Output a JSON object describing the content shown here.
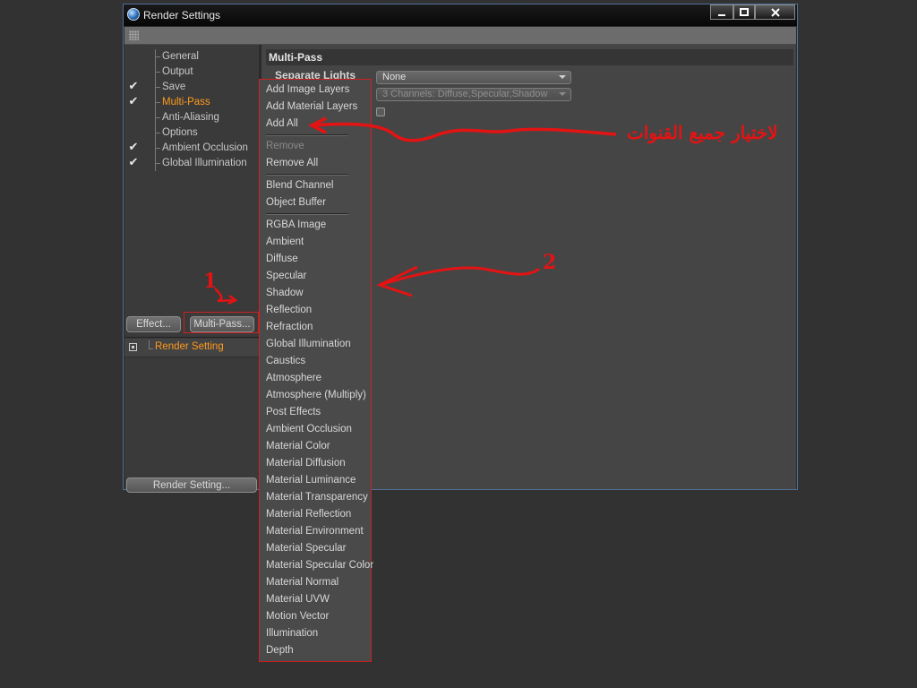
{
  "window": {
    "title": "Render Settings",
    "buttons": [
      "minimize",
      "maximize",
      "close"
    ]
  },
  "tree": {
    "items": [
      {
        "label": "General",
        "checked": false,
        "active": false
      },
      {
        "label": "Output",
        "checked": false,
        "active": false
      },
      {
        "label": "Save",
        "checked": true,
        "active": false
      },
      {
        "label": "Multi-Pass",
        "checked": true,
        "active": true
      },
      {
        "label": "Anti-Aliasing",
        "checked": false,
        "active": false
      },
      {
        "label": "Options",
        "checked": false,
        "active": false
      },
      {
        "label": "Ambient Occlusion",
        "checked": true,
        "active": false
      },
      {
        "label": "Global Illumination",
        "checked": true,
        "active": false
      }
    ],
    "check_glyph": "✔"
  },
  "buttons": {
    "effect": "Effect...",
    "multipass": "Multi-Pass...",
    "render_setting": "Render Setting..."
  },
  "render_setting_item": "Render Setting",
  "section": {
    "title": "Multi-Pass",
    "separate_lights_label": "Separate Lights",
    "separate_lights_value": "None",
    "mode_value": "3 Channels: Diffuse,Specular,Shadow"
  },
  "menu": {
    "items": [
      {
        "label": "Add Image Layers",
        "disabled": false
      },
      {
        "label": "Add Material Layers",
        "disabled": false
      },
      {
        "label": "Add All",
        "disabled": false
      },
      {
        "label": "Remove",
        "disabled": true
      },
      {
        "label": "Remove All",
        "disabled": false
      },
      {
        "label": "Blend Channel",
        "disabled": false
      },
      {
        "label": "Object Buffer",
        "disabled": false
      },
      {
        "label": "RGBA Image",
        "disabled": false
      },
      {
        "label": "Ambient",
        "disabled": false
      },
      {
        "label": "Diffuse",
        "disabled": false
      },
      {
        "label": "Specular",
        "disabled": false
      },
      {
        "label": "Shadow",
        "disabled": false
      },
      {
        "label": "Reflection",
        "disabled": false
      },
      {
        "label": "Refraction",
        "disabled": false
      },
      {
        "label": "Global Illumination",
        "disabled": false
      },
      {
        "label": "Caustics",
        "disabled": false
      },
      {
        "label": "Atmosphere",
        "disabled": false
      },
      {
        "label": "Atmosphere (Multiply)",
        "disabled": false
      },
      {
        "label": "Post Effects",
        "disabled": false
      },
      {
        "label": "Ambient Occlusion",
        "disabled": false
      },
      {
        "label": "Material Color",
        "disabled": false
      },
      {
        "label": "Material Diffusion",
        "disabled": false
      },
      {
        "label": "Material Luminance",
        "disabled": false
      },
      {
        "label": "Material Transparency",
        "disabled": false
      },
      {
        "label": "Material Reflection",
        "disabled": false
      },
      {
        "label": "Material Environment",
        "disabled": false
      },
      {
        "label": "Material Specular",
        "disabled": false
      },
      {
        "label": "Material Specular Color",
        "disabled": false
      },
      {
        "label": "Material Normal",
        "disabled": false
      },
      {
        "label": "Material UVW",
        "disabled": false
      },
      {
        "label": "Motion Vector",
        "disabled": false
      },
      {
        "label": "Illumination",
        "disabled": false
      },
      {
        "label": "Depth",
        "disabled": false
      }
    ]
  },
  "annotations": {
    "arabic_note": "لاختيار جميع القنوات",
    "marker_1": "1",
    "marker_2": "2",
    "color": "#e41313"
  }
}
